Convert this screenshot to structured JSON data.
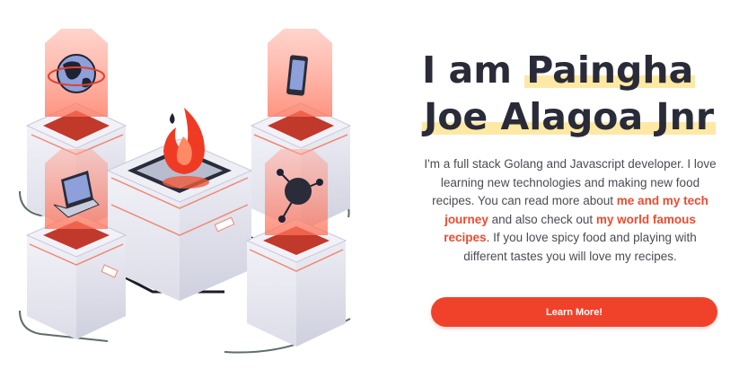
{
  "hero": {
    "heading": {
      "line1_prefix": "I am ",
      "line1_highlight": "Paingha",
      "line2_highlight": "Joe Alagoa Jnr"
    },
    "bio": {
      "part1": "I'm a full stack Golang and Javascript developer. I love learning new technologies and making new food recipes. You can read more about ",
      "link1": "me and my tech journey",
      "part2": " and also check out ",
      "link2": "my world famous recipes",
      "part3": ". If you love spicy food and playing with different tastes you will love my recipes."
    },
    "cta_label": "Learn More!"
  },
  "colors": {
    "accent": "#f0422a",
    "highlight": "#fde9a5",
    "heading": "#2a2b38",
    "body_text": "#4b4b55"
  },
  "illustration": {
    "icons": [
      "globe-icon",
      "smartphone-icon",
      "laptop-icon",
      "molecule-icon",
      "flame-logo-icon"
    ]
  }
}
